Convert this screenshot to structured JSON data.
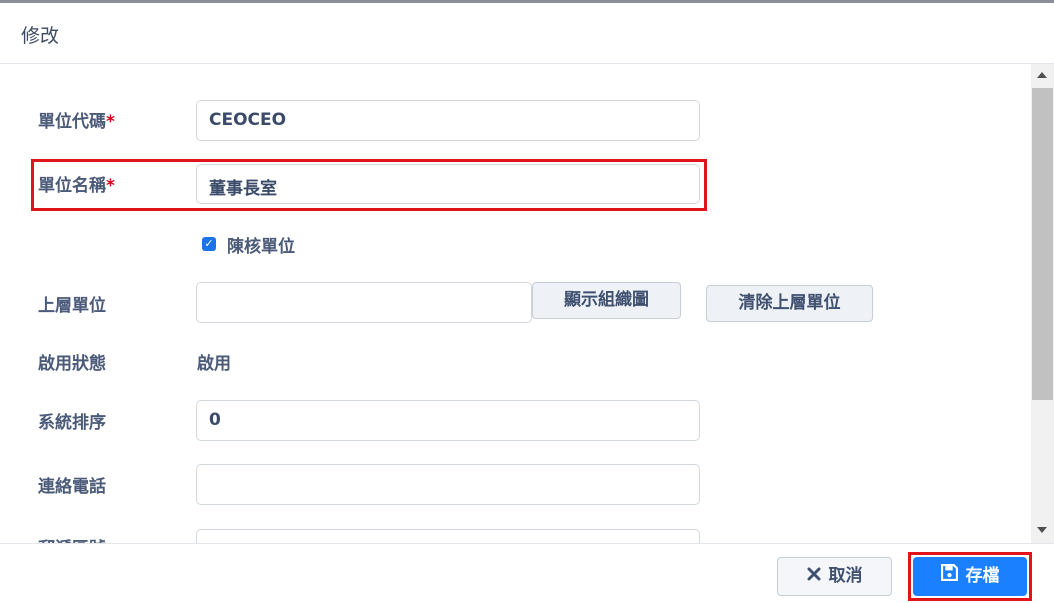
{
  "dialog": {
    "title": "修改"
  },
  "form": {
    "unit_code": {
      "label": "單位代碼",
      "required_mark": "*",
      "value": "CEOCEO"
    },
    "unit_name": {
      "label": "單位名稱",
      "required_mark": "*",
      "value": "董事長室"
    },
    "approval_unit": {
      "label": "陳核單位",
      "checked": true
    },
    "parent_unit": {
      "label": "上層單位",
      "value": "",
      "show_org_chart_label": "顯示組織圖",
      "clear_parent_label": "清除上層單位"
    },
    "enabled_status": {
      "label": "啟用狀態",
      "value": "啟用"
    },
    "sort_order": {
      "label": "系統排序",
      "value": "0"
    },
    "contact_phone": {
      "label": "連絡電話",
      "value": ""
    },
    "postal_code": {
      "label": "郵遞區號",
      "value": ""
    }
  },
  "footer": {
    "cancel_label": "取消",
    "cancel_icon": "close-icon",
    "save_label": "存檔",
    "save_icon": "floppy-disk-icon"
  },
  "colors": {
    "primary": "#1a80ff",
    "highlight": "#e0141b",
    "required": "#d0021b"
  }
}
